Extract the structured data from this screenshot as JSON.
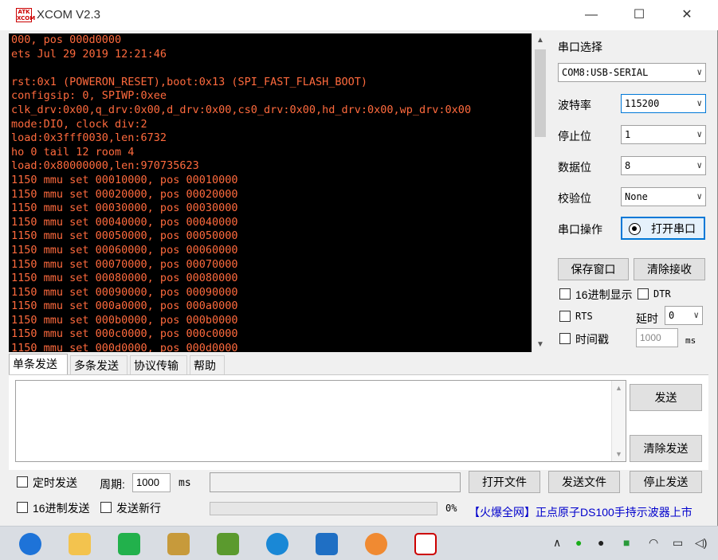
{
  "window": {
    "title": "XCOM V2.3",
    "logo_text": "ATK XCOM",
    "min_glyph": "—",
    "max_glyph": "☐",
    "close_glyph": "✕"
  },
  "terminal": {
    "lines": [
      "000, pos 000d0000",
      "ets Jul 29 2019 12:21:46",
      "",
      "rst:0x1 (POWERON_RESET),boot:0x13 (SPI_FAST_FLASH_BOOT)",
      "configsip: 0, SPIWP:0xee",
      "clk_drv:0x00,q_drv:0x00,d_drv:0x00,cs0_drv:0x00,hd_drv:0x00,wp_drv:0x00",
      "mode:DIO, clock div:2",
      "load:0x3fff0030,len:6732",
      "ho 0 tail 12 room 4",
      "load:0x80000000,len:970735623",
      "1150 mmu set 00010000, pos 00010000",
      "1150 mmu set 00020000, pos 00020000",
      "1150 mmu set 00030000, pos 00030000",
      "1150 mmu set 00040000, pos 00040000",
      "1150 mmu set 00050000, pos 00050000",
      "1150 mmu set 00060000, pos 00060000",
      "1150 mmu set 00070000, pos 00070000",
      "1150 mmu set 00080000, pos 00080000",
      "1150 mmu set 00090000, pos 00090000",
      "1150 mmu set 000a0000, pos 000a0000",
      "1150 mmu set 000b0000, pos 000b0000",
      "1150 mmu set 000c0000, pos 000c0000",
      "1150 mmu set 000d0000, pos 000d0000"
    ]
  },
  "settings": {
    "port_select_label": "串口选择",
    "port_value": "COM8:USB-SERIAL",
    "baud_label": "波特率",
    "baud_value": "115200",
    "stopbits_label": "停止位",
    "stopbits_value": "1",
    "databits_label": "数据位",
    "databits_value": "8",
    "parity_label": "校验位",
    "parity_value": "None",
    "port_op_label": "串口操作",
    "open_port_label": "打开串口",
    "save_window_label": "保存窗口",
    "clear_recv_label": "清除接收",
    "hex_display_label": "16进制显示",
    "dtr_label": "DTR",
    "rts_label": "RTS",
    "delay_label": "延时",
    "delay_value": "0",
    "timestamp_label": "时间戳",
    "timestamp_value": "1000",
    "ms_label": "ms"
  },
  "tabs": [
    "单条发送",
    "多条发送",
    "协议传输",
    "帮助"
  ],
  "send": {
    "send_label": "发送",
    "clear_send_label": "清除发送",
    "timed_send_label": "定时发送",
    "period_label": "周期:",
    "period_value": "1000",
    "ms_label": "ms",
    "open_file_label": "打开文件",
    "send_file_label": "发送文件",
    "stop_send_label": "停止发送",
    "hex_send_label": "16进制发送",
    "send_newline_label": "发送新行",
    "progress_percent": 0,
    "progress_text": "0%",
    "ad_text": "【火爆全网】正点原子DS100手持示波器上市"
  },
  "colors": {
    "terminal_bg": "#000000",
    "terminal_text": "#ff6a3d",
    "accent": "#0078d7"
  },
  "taskbar": {
    "icons": [
      "browser-icon",
      "file-explorer-icon",
      "iqiyi-icon",
      "pads-icon",
      "pads-layout-icon",
      "settings-icon",
      "3d-box-icon",
      "audio-icon",
      "xcom-icon"
    ],
    "tray": [
      "chevron-up-icon",
      "wechat-icon",
      "qq-icon",
      "security-icon",
      "wifi-icon",
      "battery-icon",
      "volume-icon"
    ]
  }
}
